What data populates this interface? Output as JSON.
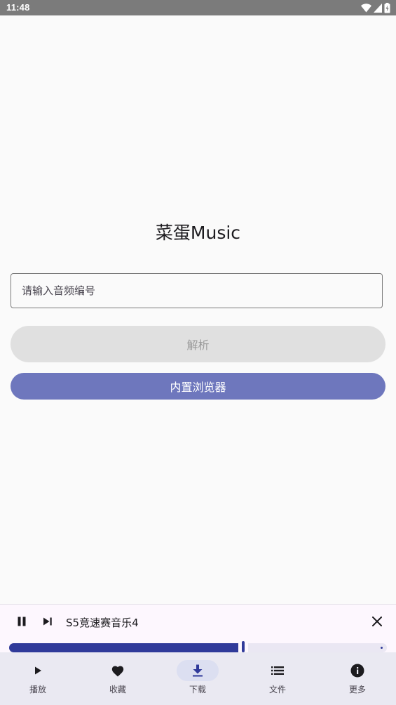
{
  "status_bar": {
    "time": "11:48",
    "icons": [
      "wifi-icon",
      "signal-icon",
      "battery-icon"
    ]
  },
  "main": {
    "title": "菜蛋Music",
    "input": {
      "placeholder": "请输入音频编号",
      "value": ""
    },
    "parse_button": "解析",
    "browser_button": "内置浏览器"
  },
  "player": {
    "song_title": "S5竞速赛音乐4",
    "progress": 0.62,
    "icons": [
      "pause-icon",
      "skip-next-icon",
      "close-icon"
    ]
  },
  "bottom_nav": {
    "items": [
      {
        "label": "播放",
        "icon": "play-icon"
      },
      {
        "label": "收藏",
        "icon": "heart-icon"
      },
      {
        "label": "下载",
        "icon": "download-icon"
      },
      {
        "label": "文件",
        "icon": "list-icon"
      },
      {
        "label": "更多",
        "icon": "info-icon"
      }
    ],
    "active_index": 2
  },
  "colors": {
    "primary": "#303a9a",
    "browser_button": "#6e77bd",
    "disabled_button": "#e0e0e0",
    "nav_background": "#eae9f2",
    "nav_indicator": "#dcdff1"
  }
}
